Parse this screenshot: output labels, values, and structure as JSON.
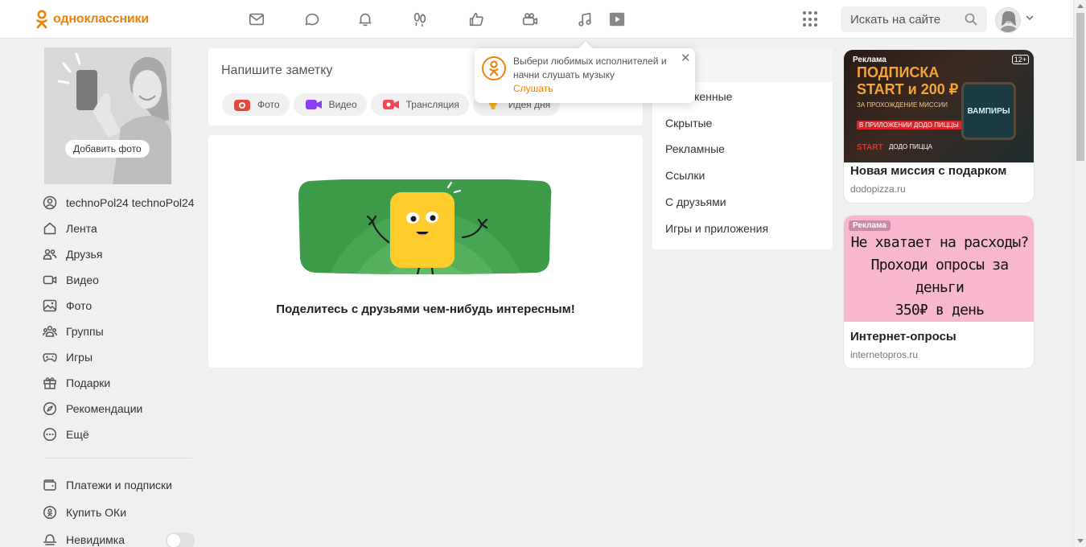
{
  "brand": {
    "name": "одноклассники",
    "color": "#ee8208"
  },
  "header": {
    "nav_icons": [
      "messages-icon",
      "discussions-icon",
      "notifications-icon",
      "guests-icon",
      "likes-icon",
      "video-calls-icon",
      "music-icon",
      "video-icon"
    ],
    "search_placeholder": "Искать на сайте"
  },
  "profile": {
    "add_photo_label": "Добавить фото",
    "name": "technoPol24 technoPol24"
  },
  "sidebar": {
    "items": [
      {
        "label": "Лента",
        "icon": "home-icon"
      },
      {
        "label": "Друзья",
        "icon": "friends-icon"
      },
      {
        "label": "Видео",
        "icon": "video-camera-icon"
      },
      {
        "label": "Фото",
        "icon": "photo-icon"
      },
      {
        "label": "Группы",
        "icon": "groups-icon"
      },
      {
        "label": "Игры",
        "icon": "gamepad-icon"
      },
      {
        "label": "Подарки",
        "icon": "gift-icon"
      },
      {
        "label": "Рекомендации",
        "icon": "compass-icon"
      },
      {
        "label": "Ещё",
        "icon": "more-icon"
      }
    ],
    "secondary": [
      {
        "label": "Платежи и подписки",
        "icon": "wallet-icon"
      },
      {
        "label": "Купить ОКи",
        "icon": "ok-coin-icon"
      },
      {
        "label": "Невидимка",
        "icon": "invisible-icon"
      }
    ],
    "invisible_enabled": false
  },
  "composer": {
    "placeholder": "Напишите заметку",
    "actions": [
      {
        "label": "Фото",
        "color": "#e8453c"
      },
      {
        "label": "Видео",
        "color": "#8b3cf5"
      },
      {
        "label": "Трансляция",
        "color": "#f04a5a"
      },
      {
        "label": "Идея дня",
        "color": "#f2b21a"
      }
    ]
  },
  "feed": {
    "empty_text": "Поделитесь с друзьями чем-нибудь интересным!"
  },
  "filters": {
    "items": [
      "Отложенные",
      "Скрытые",
      "Рекламные",
      "Ссылки",
      "С друзьями",
      "Игры и приложения"
    ]
  },
  "popup": {
    "text": "Выбери любимых исполнителей и начни слушать музыку",
    "link": "Слушать"
  },
  "ads": [
    {
      "label": "Реклама",
      "age": "12+",
      "promo_line1": "ПОДПИСКА",
      "promo_line2": "START и 200 ₽",
      "promo_small": "ЗА ПРОХОЖДЕНИЕ МИССИИ",
      "promo_tag": "В ПРИЛОЖЕНИИ ДОДО ПИЦЦЫ",
      "show": "ВАМПИРЫ",
      "brand1": "START",
      "brand2": "ДОДО ПИЦЦА",
      "title": "Новая миссия с подарком",
      "domain": "dodopizza.ru"
    },
    {
      "label": "Реклама",
      "promo_line1": "Не хватает на расходы?",
      "promo_line2": "Проходи опросы за деньги",
      "promo_line3": "350₽ в день",
      "title": "Интернет-опросы",
      "domain": "internetopros.ru"
    }
  ]
}
